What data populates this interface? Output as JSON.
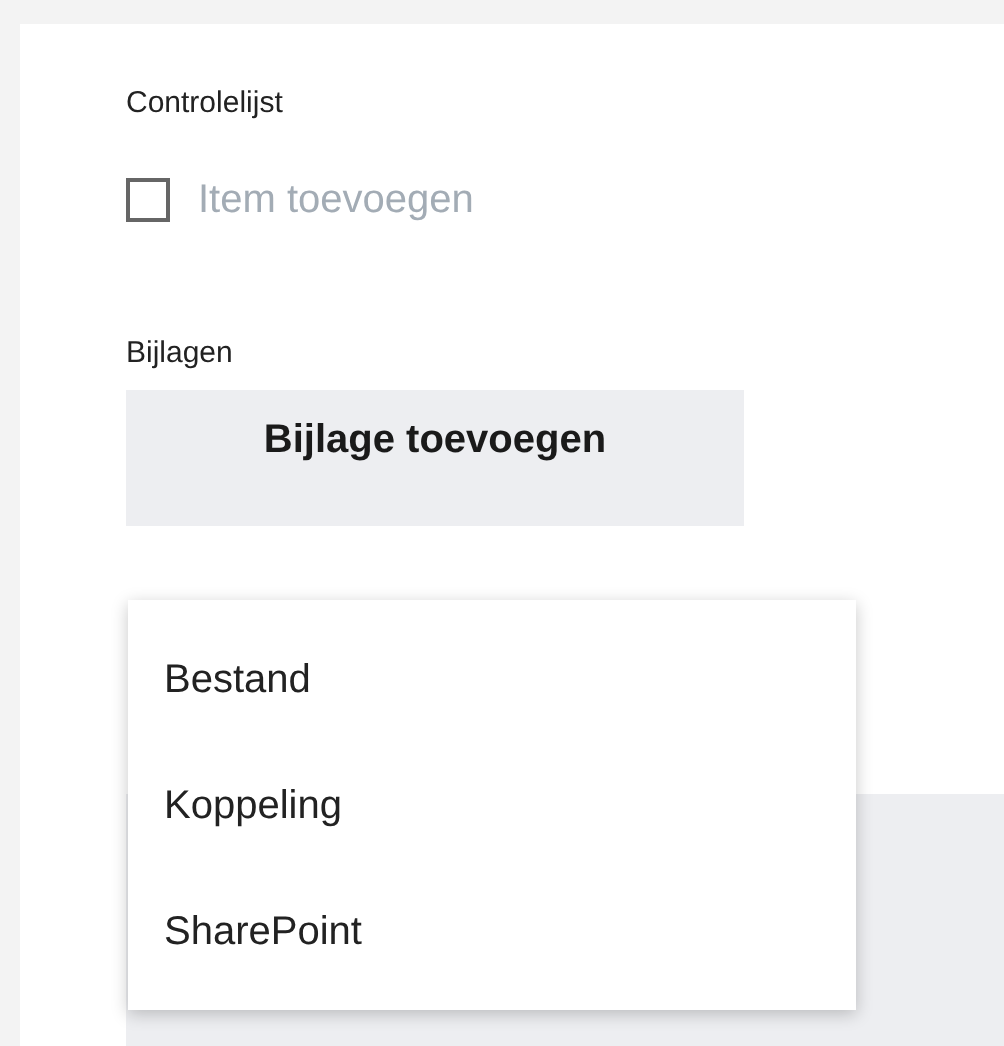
{
  "checklist": {
    "label": "Controlelijst",
    "checkbox": {
      "checked": false
    },
    "placeholder": "Item toevoegen"
  },
  "attachments": {
    "label": "Bijlagen",
    "button": "Bijlage toevoegen",
    "menu": {
      "items": [
        {
          "label": "Bestand"
        },
        {
          "label": "Koppeling"
        },
        {
          "label": "SharePoint"
        }
      ]
    }
  }
}
